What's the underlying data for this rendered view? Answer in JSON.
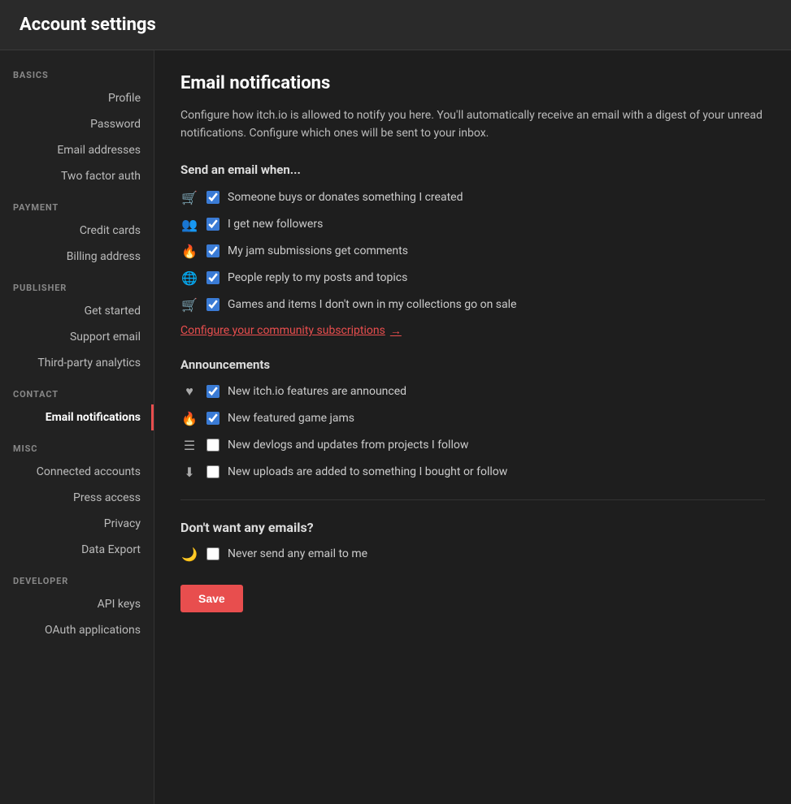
{
  "header": {
    "title": "Account settings"
  },
  "sidebar": {
    "sections": [
      {
        "label": "BASICS",
        "items": [
          {
            "id": "profile",
            "text": "Profile",
            "active": false
          },
          {
            "id": "password",
            "text": "Password",
            "active": false
          },
          {
            "id": "email-addresses",
            "text": "Email addresses",
            "active": false
          },
          {
            "id": "two-factor-auth",
            "text": "Two factor auth",
            "active": false
          }
        ]
      },
      {
        "label": "PAYMENT",
        "items": [
          {
            "id": "credit-cards",
            "text": "Credit cards",
            "active": false
          },
          {
            "id": "billing-address",
            "text": "Billing address",
            "active": false
          }
        ]
      },
      {
        "label": "PUBLISHER",
        "items": [
          {
            "id": "get-started",
            "text": "Get started",
            "active": false
          },
          {
            "id": "support-email",
            "text": "Support email",
            "active": false
          },
          {
            "id": "third-party-analytics",
            "text": "Third-party analytics",
            "active": false
          }
        ]
      },
      {
        "label": "CONTACT",
        "items": [
          {
            "id": "email-notifications",
            "text": "Email notifications",
            "active": true
          }
        ]
      },
      {
        "label": "MISC",
        "items": [
          {
            "id": "connected-accounts",
            "text": "Connected accounts",
            "active": false
          },
          {
            "id": "press-access",
            "text": "Press access",
            "active": false
          },
          {
            "id": "privacy",
            "text": "Privacy",
            "active": false
          },
          {
            "id": "data-export",
            "text": "Data Export",
            "active": false
          }
        ]
      },
      {
        "label": "DEVELOPER",
        "items": [
          {
            "id": "api-keys",
            "text": "API keys",
            "active": false
          },
          {
            "id": "oauth-applications",
            "text": "OAuth applications",
            "active": false
          }
        ]
      }
    ]
  },
  "main": {
    "page_title": "Email notifications",
    "description": "Configure how itch.io is allowed to notify you here. You'll automatically receive an email with a digest of your unread notifications. Configure which ones will be sent to your inbox.",
    "send_when_heading": "Send an email when...",
    "send_when_items": [
      {
        "id": "buys-donates",
        "icon": "🛒",
        "label": "Someone buys or donates something I created",
        "checked": true
      },
      {
        "id": "new-followers",
        "icon": "👥",
        "label": "I get new followers",
        "checked": true
      },
      {
        "id": "jam-comments",
        "icon": "🔥",
        "label": "My jam submissions get comments",
        "checked": true
      },
      {
        "id": "reply-posts",
        "icon": "🌐",
        "label": "People reply to my posts and topics",
        "checked": true
      },
      {
        "id": "games-sale",
        "icon": "🛒",
        "label": "Games and items I don't own in my collections go on sale",
        "checked": true
      }
    ],
    "configure_link": "Configure your community subscriptions",
    "configure_arrow": "→",
    "announcements_heading": "Announcements",
    "announcements_items": [
      {
        "id": "new-features",
        "icon": "♥",
        "label": "New itch.io features are announced",
        "checked": true
      },
      {
        "id": "featured-jams",
        "icon": "🔥",
        "label": "New featured game jams",
        "checked": true
      },
      {
        "id": "devlogs",
        "icon": "☰",
        "label": "New devlogs and updates from projects I follow",
        "checked": false
      },
      {
        "id": "new-uploads",
        "icon": "⬇",
        "label": "New uploads are added to something I bought or follow",
        "checked": false
      }
    ],
    "dont_want_heading": "Don't want any emails?",
    "never_send_label": "Never send any email to me",
    "never_send_checked": false,
    "save_button": "Save"
  }
}
